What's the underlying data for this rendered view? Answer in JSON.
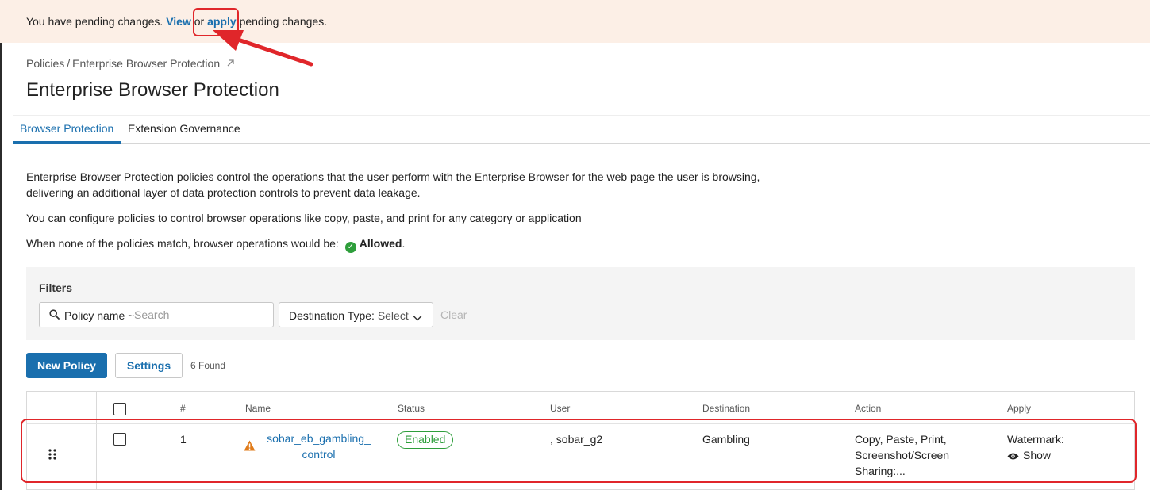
{
  "banner": {
    "prefix": "You have pending changes.",
    "view_link": "View",
    "or_text": "or",
    "apply_link": "apply",
    "suffix": "pending changes."
  },
  "breadcrumb": {
    "parent": "Policies",
    "separator": "/",
    "current": "Enterprise Browser Protection",
    "link_icon": "link-icon"
  },
  "page_title": "Enterprise Browser Protection",
  "tabs": [
    {
      "label": "Browser Protection",
      "active": true
    },
    {
      "label": "Extension Governance",
      "active": false
    }
  ],
  "description": {
    "line1": "Enterprise Browser Protection policies control the operations that the user perform with the Enterprise Browser for the web page the user is browsing,",
    "line2": "delivering an additional layer of data protection controls to prevent data leakage.",
    "line3": "You can configure policies to control browser operations like copy, paste, and print for any category or application",
    "default_prefix": "When none of the policies match, browser operations would be:",
    "default_value": "Allowed",
    "default_suffix": "."
  },
  "filters": {
    "label": "Filters",
    "search_label": "Policy name",
    "search_operator": "~",
    "search_placeholder": "Search",
    "destination_label": "Destination Type",
    "destination_value": "Select",
    "clear_label": "Clear"
  },
  "toolbar": {
    "new_policy": "New Policy",
    "settings": "Settings",
    "found_count": "6 Found"
  },
  "table": {
    "headers": {
      "number": "#",
      "name": "Name",
      "status": "Status",
      "user": "User",
      "destination": "Destination",
      "action": "Action",
      "apply": "Apply"
    },
    "rows": [
      {
        "number": "1",
        "name": "sobar_eb_gambling_control",
        "status": "Enabled",
        "user": ", sobar_g2",
        "destination": "Gambling",
        "action": "Copy, Paste, Print, Screenshot/Screen Sharing:...",
        "apply_label": "Watermark:",
        "apply_value": "Show"
      }
    ]
  },
  "colors": {
    "accent": "#1a6fae",
    "banner_bg": "#fcefe6",
    "success": "#2e9e3b",
    "warning": "#e07b1a",
    "annotation": "#e0262a"
  }
}
